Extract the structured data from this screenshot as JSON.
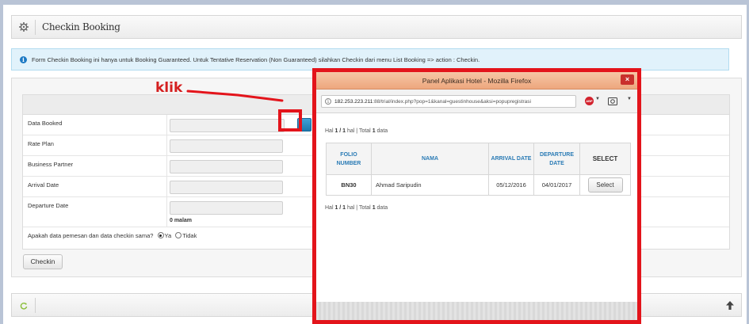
{
  "header": {
    "title": "Checkin Booking",
    "icon": "gear-icon"
  },
  "alert": {
    "icon": "info-icon",
    "text": "Form Checkin Booking ini hanya untuk Booking Guaranteed. Untuk Tentative Reservation (Non Guaranteed) silahkan Checkin dari menu List Booking => action : Checkin."
  },
  "form": {
    "rows": [
      {
        "label": "Data Booked"
      },
      {
        "label": "Rate Plan"
      },
      {
        "label": "Business Partner"
      },
      {
        "label": "Arrival Date"
      },
      {
        "label": "Departure Date"
      }
    ],
    "nights_text": "0 malam",
    "question": "Apakah data pemesan dan data checkin sama?",
    "option_yes": "Ya",
    "option_no": "Tidak",
    "selected_option": "Ya",
    "checkin_label": "Checkin"
  },
  "annotation": {
    "text": "klik",
    "color": "#e3141b"
  },
  "popup": {
    "title": "Panel Aplikasi Hotel - Mozilla Firefox",
    "close_label": "×",
    "url_host": "182.253.223.211",
    "url_path": ":88/trial/index.php?pop=1&kanal=guestinhouse&aksi=popupregistrasi",
    "pagination_top": {
      "prefix": "Hal ",
      "page": "1 / 1",
      "mid": " hal | Total ",
      "total": "1",
      "suffix": " data"
    },
    "pagination_bottom": {
      "prefix": "Hal ",
      "page": "1 / 1",
      "mid": " hal | Total ",
      "total": "1",
      "suffix": " data"
    },
    "columns": [
      "FOLIO NUMBER",
      "NAMA",
      "ARRIVAL DATE",
      "DEPARTURE DATE",
      "SELECT"
    ],
    "rows": [
      {
        "folio": "BN30",
        "nama": "Ahmad Saripudin",
        "arrival": "05/12/2016",
        "departure": "04/01/2017",
        "select_label": "Select"
      }
    ]
  }
}
